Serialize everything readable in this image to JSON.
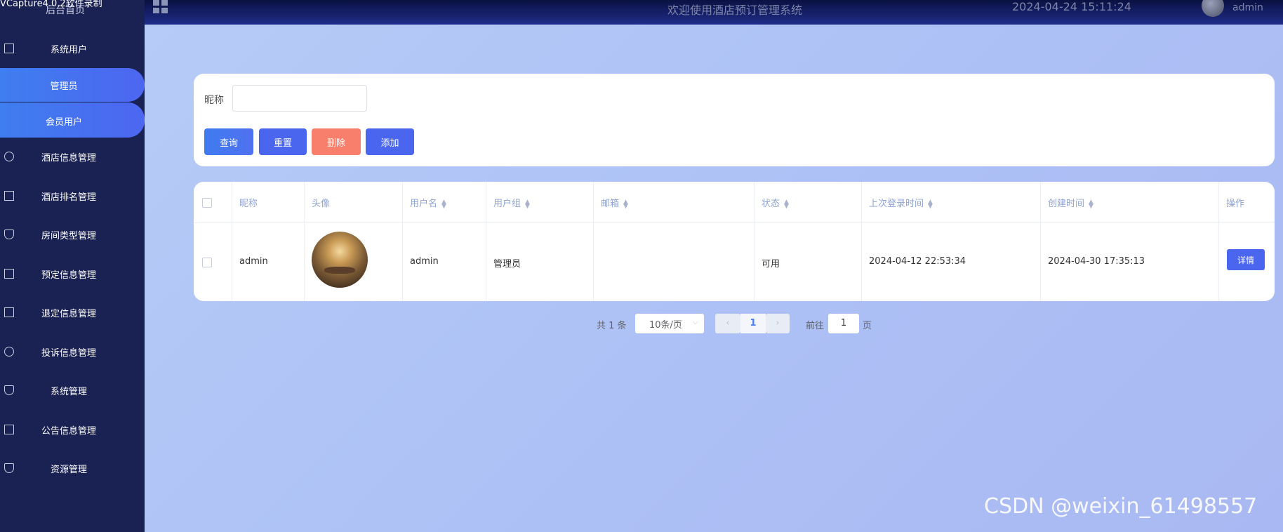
{
  "recorder_watermark": "VCapture4.0.2软件录制",
  "header": {
    "title": "欢迎使用酒店预订管理系统",
    "datetime": "2024-04-24 15:11:24",
    "username": "admin"
  },
  "sidebar": {
    "home": "后台首页",
    "items": [
      {
        "label": "系统用户",
        "icon": "columns-icon"
      },
      {
        "label": "酒店信息管理",
        "icon": "chat-icon"
      },
      {
        "label": "酒店排名管理",
        "icon": "document-icon"
      },
      {
        "label": "房间类型管理",
        "icon": "shield-icon"
      },
      {
        "label": "预定信息管理",
        "icon": "columns-icon"
      },
      {
        "label": "退定信息管理",
        "icon": "document-icon"
      },
      {
        "label": "投诉信息管理",
        "icon": "chat-icon"
      },
      {
        "label": "系统管理",
        "icon": "shield-icon"
      },
      {
        "label": "公告信息管理",
        "icon": "document-icon"
      },
      {
        "label": "资源管理",
        "icon": "shield-icon"
      }
    ],
    "submenu": [
      {
        "label": "管理员"
      },
      {
        "label": "会员用户"
      }
    ]
  },
  "search": {
    "nickname_label": "昵称",
    "nickname_value": "",
    "buttons": {
      "query": "查询",
      "reset": "重置",
      "delete": "删除",
      "add": "添加"
    }
  },
  "table": {
    "headers": {
      "nickname": "昵称",
      "avatar": "头像",
      "username": "用户名",
      "group": "用户组",
      "email": "邮箱",
      "status": "状态",
      "last_login": "上次登录时间",
      "created": "创建时间",
      "actions": "操作"
    },
    "rows": [
      {
        "nickname": "admin",
        "username": "admin",
        "group": "管理员",
        "email": "",
        "status": "可用",
        "last_login": "2024-04-12 22:53:34",
        "created": "2024-04-30 17:35:13",
        "action": "详情"
      }
    ]
  },
  "pagination": {
    "total": "共 1 条",
    "page_size": "10条/页",
    "current": "1",
    "goto_label": "前往",
    "goto_value": "1",
    "page_suffix": "页"
  },
  "watermark": "CSDN @weixin_61498557",
  "colors": {
    "sidebar": "#1a2153",
    "accent": "#4a66ee",
    "danger": "#f77f6b"
  }
}
